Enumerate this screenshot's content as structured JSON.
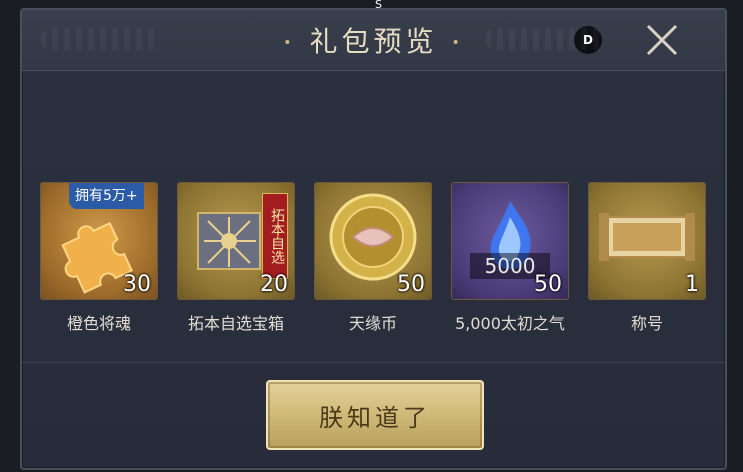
{
  "top_marker": "S",
  "header": {
    "title": "礼包预览",
    "title_dot_left": "•",
    "title_dot_right": "•",
    "badge": "D",
    "close_icon": "close-x-icon"
  },
  "items": [
    {
      "name": "橙色将魂",
      "count": "30",
      "badge": "拥有5万+",
      "icon": "orange-puzzle-piece-icon",
      "tile_color": "#a06c2a"
    },
    {
      "name": "拓本自选宝箱",
      "count": "20",
      "label": "拓本自选",
      "icon": "gold-chest-icon",
      "tile_color": "#8d7432"
    },
    {
      "name": "天缘币",
      "count": "50",
      "icon": "gold-coin-icon",
      "tile_color": "#8d7432"
    },
    {
      "name": "5,000太初之气",
      "count": "50",
      "amount": "5000",
      "icon": "blue-flame-icon",
      "tile_color": "#4a3c78"
    },
    {
      "name": "称号",
      "count": "1",
      "icon": "title-scroll-icon",
      "tile_color": "#8d7432"
    }
  ],
  "footer": {
    "confirm_label": "朕知道了"
  },
  "colors": {
    "panel_bg": "#2c3140",
    "title_text": "#e6dcc2",
    "button_gold": "#cdb776",
    "count_text": "#ffffff"
  }
}
